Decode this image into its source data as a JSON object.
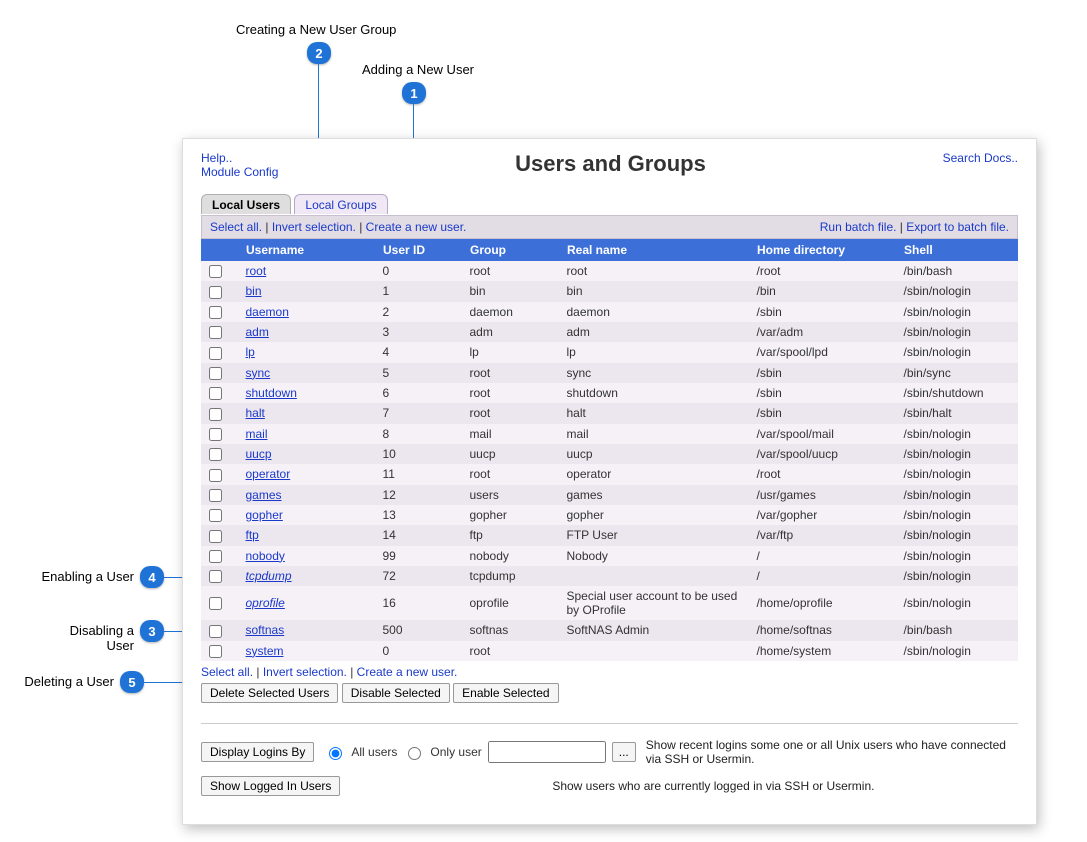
{
  "callouts": {
    "c1": {
      "label": "Adding a New User",
      "num": "1"
    },
    "c2": {
      "label": "Creating a New User Group",
      "num": "2"
    },
    "c3": {
      "label": "Disabling a User",
      "num": "3"
    },
    "c4": {
      "label": "Enabling a User",
      "num": "4"
    },
    "c5": {
      "label": "Deleting a User",
      "num": "5"
    }
  },
  "header": {
    "help": "Help..",
    "module_config": "Module Config",
    "title": "Users and Groups",
    "search_docs": "Search Docs.."
  },
  "tabs": {
    "local_users": "Local Users",
    "local_groups": "Local Groups"
  },
  "toolbar": {
    "select_all": "Select all.",
    "invert": "Invert selection.",
    "create_user": "Create a new user.",
    "run_batch": "Run batch file.",
    "export_batch": "Export to batch file."
  },
  "columns": {
    "c0": "",
    "c1": "Username",
    "c2": "User ID",
    "c3": "Group",
    "c4": "Real name",
    "c5": "Home directory",
    "c6": "Shell"
  },
  "rows": [
    {
      "u": "root",
      "id": "0",
      "g": "root",
      "rn": "root",
      "h": "/root",
      "s": "/bin/bash"
    },
    {
      "u": "bin",
      "id": "1",
      "g": "bin",
      "rn": "bin",
      "h": "/bin",
      "s": "/sbin/nologin"
    },
    {
      "u": "daemon",
      "id": "2",
      "g": "daemon",
      "rn": "daemon",
      "h": "/sbin",
      "s": "/sbin/nologin"
    },
    {
      "u": "adm",
      "id": "3",
      "g": "adm",
      "rn": "adm",
      "h": "/var/adm",
      "s": "/sbin/nologin"
    },
    {
      "u": "lp",
      "id": "4",
      "g": "lp",
      "rn": "lp",
      "h": "/var/spool/lpd",
      "s": "/sbin/nologin"
    },
    {
      "u": "sync",
      "id": "5",
      "g": "root",
      "rn": "sync",
      "h": "/sbin",
      "s": "/bin/sync"
    },
    {
      "u": "shutdown",
      "id": "6",
      "g": "root",
      "rn": "shutdown",
      "h": "/sbin",
      "s": "/sbin/shutdown"
    },
    {
      "u": "halt",
      "id": "7",
      "g": "root",
      "rn": "halt",
      "h": "/sbin",
      "s": "/sbin/halt"
    },
    {
      "u": "mail",
      "id": "8",
      "g": "mail",
      "rn": "mail",
      "h": "/var/spool/mail",
      "s": "/sbin/nologin"
    },
    {
      "u": "uucp",
      "id": "10",
      "g": "uucp",
      "rn": "uucp",
      "h": "/var/spool/uucp",
      "s": "/sbin/nologin"
    },
    {
      "u": "operator",
      "id": "11",
      "g": "root",
      "rn": "operator",
      "h": "/root",
      "s": "/sbin/nologin"
    },
    {
      "u": "games",
      "id": "12",
      "g": "users",
      "rn": "games",
      "h": "/usr/games",
      "s": "/sbin/nologin"
    },
    {
      "u": "gopher",
      "id": "13",
      "g": "gopher",
      "rn": "gopher",
      "h": "/var/gopher",
      "s": "/sbin/nologin"
    },
    {
      "u": "ftp",
      "id": "14",
      "g": "ftp",
      "rn": "FTP User",
      "h": "/var/ftp",
      "s": "/sbin/nologin"
    },
    {
      "u": "nobody",
      "id": "99",
      "g": "nobody",
      "rn": "Nobody",
      "h": "/",
      "s": "/sbin/nologin"
    },
    {
      "u": "tcpdump",
      "id": "72",
      "g": "tcpdump",
      "rn": "",
      "h": "/",
      "s": "/sbin/nologin",
      "italic": true
    },
    {
      "u": "oprofile",
      "id": "16",
      "g": "oprofile",
      "rn": "Special user account to be used by OProfile",
      "h": "/home/oprofile",
      "s": "/sbin/nologin",
      "italic": true
    },
    {
      "u": "softnas",
      "id": "500",
      "g": "softnas",
      "rn": "SoftNAS Admin",
      "h": "/home/softnas",
      "s": "/bin/bash"
    },
    {
      "u": "system",
      "id": "0",
      "g": "root",
      "rn": "",
      "h": "/home/system",
      "s": "/sbin/nologin"
    }
  ],
  "buttons": {
    "delete": "Delete Selected Users",
    "disable": "Disable Selected",
    "enable": "Enable Selected",
    "display_logins": "Display Logins By",
    "show_logged_in": "Show Logged In Users",
    "browse": "..."
  },
  "login_filter": {
    "all_users": "All users",
    "only_user": "Only user",
    "desc1": "Show recent logins some one or all Unix users who have connected via SSH or Usermin.",
    "desc2": "Show users who are currently logged in via SSH or Usermin."
  }
}
